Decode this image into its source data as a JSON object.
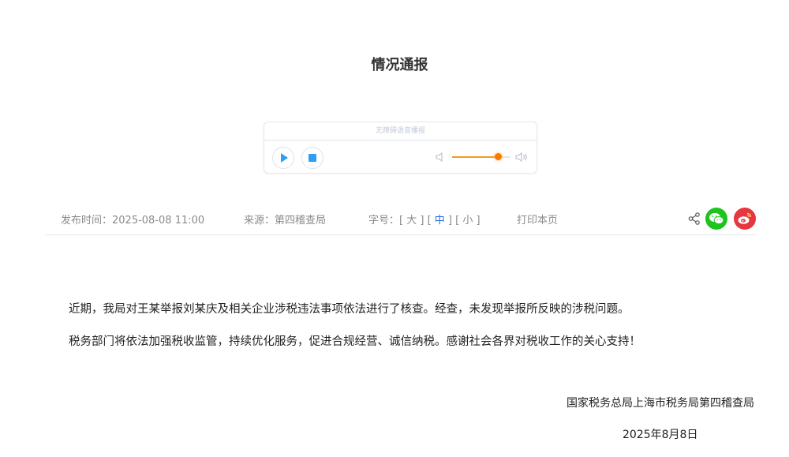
{
  "article": {
    "title": "情况通报",
    "paragraphs": [
      "近期，我局对王某举报刘某庆及相关企业涉税违法事项依法进行了核查。经查，未发现举报所反映的涉税问题。",
      "税务部门将依法加强税收监管，持续优化服务，促进合规经营、诚信纳税。感谢社会各界对税收工作的关心支持！"
    ],
    "signature": "国家税务总局上海市税务局第四稽查局",
    "date": "2025年8月8日"
  },
  "player": {
    "label": "无障碍语音播报",
    "volume_percent": 78
  },
  "meta": {
    "publish_label": "发布时间：",
    "publish_time": "2025-08-08 11:00",
    "source": "来源：第四稽查局",
    "font_size_label": "字号：",
    "font_sizes": [
      "大",
      "中",
      "小"
    ],
    "active_size": "中",
    "print_label": "打印本页"
  },
  "share": {
    "icons": [
      "share-icon",
      "wechat-icon",
      "weibo-icon"
    ]
  },
  "colors": {
    "accent_blue": "#2e9ff0",
    "volume_orange": "#f57c00",
    "wechat_green": "#1ec41e",
    "weibo_red": "#e6363f",
    "active_size": "#2a6fd6"
  }
}
